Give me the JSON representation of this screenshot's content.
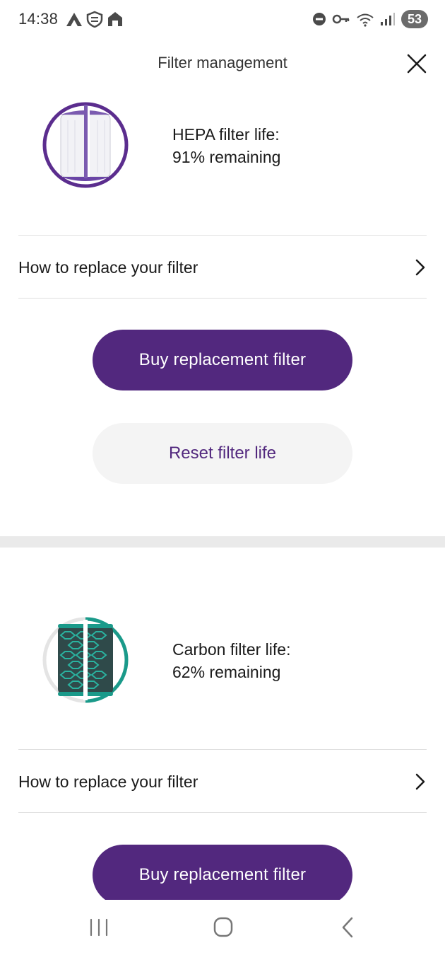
{
  "status_bar": {
    "time": "14:38",
    "battery": "53",
    "left_icons": [
      "app-notification-icon",
      "shield-notification-icon",
      "home-notification-icon"
    ],
    "right_icons": [
      "do-not-disturb-icon",
      "key-icon",
      "wifi-icon",
      "signal-icon"
    ]
  },
  "header": {
    "title": "Filter management",
    "close_icon": "close-icon"
  },
  "filters": [
    {
      "type": "hepa",
      "life_label": "HEPA filter life:",
      "remaining": "91% remaining",
      "replace_label": "How to replace your filter",
      "buy_label": "Buy replacement filter",
      "reset_label": "Reset filter life"
    },
    {
      "type": "carbon",
      "life_label": "Carbon filter life:",
      "remaining": "62% remaining",
      "replace_label": "How to replace your filter",
      "buy_label": "Buy replacement filter"
    }
  ],
  "colors": {
    "brand_purple": "#52287e",
    "hepa_accent": "#5b2d8e",
    "carbon_accent": "#1a9a8a",
    "secondary_bg": "#f4f4f4"
  },
  "nav_bar": {
    "icons": [
      "recent-apps-icon",
      "home-icon",
      "back-icon"
    ]
  }
}
